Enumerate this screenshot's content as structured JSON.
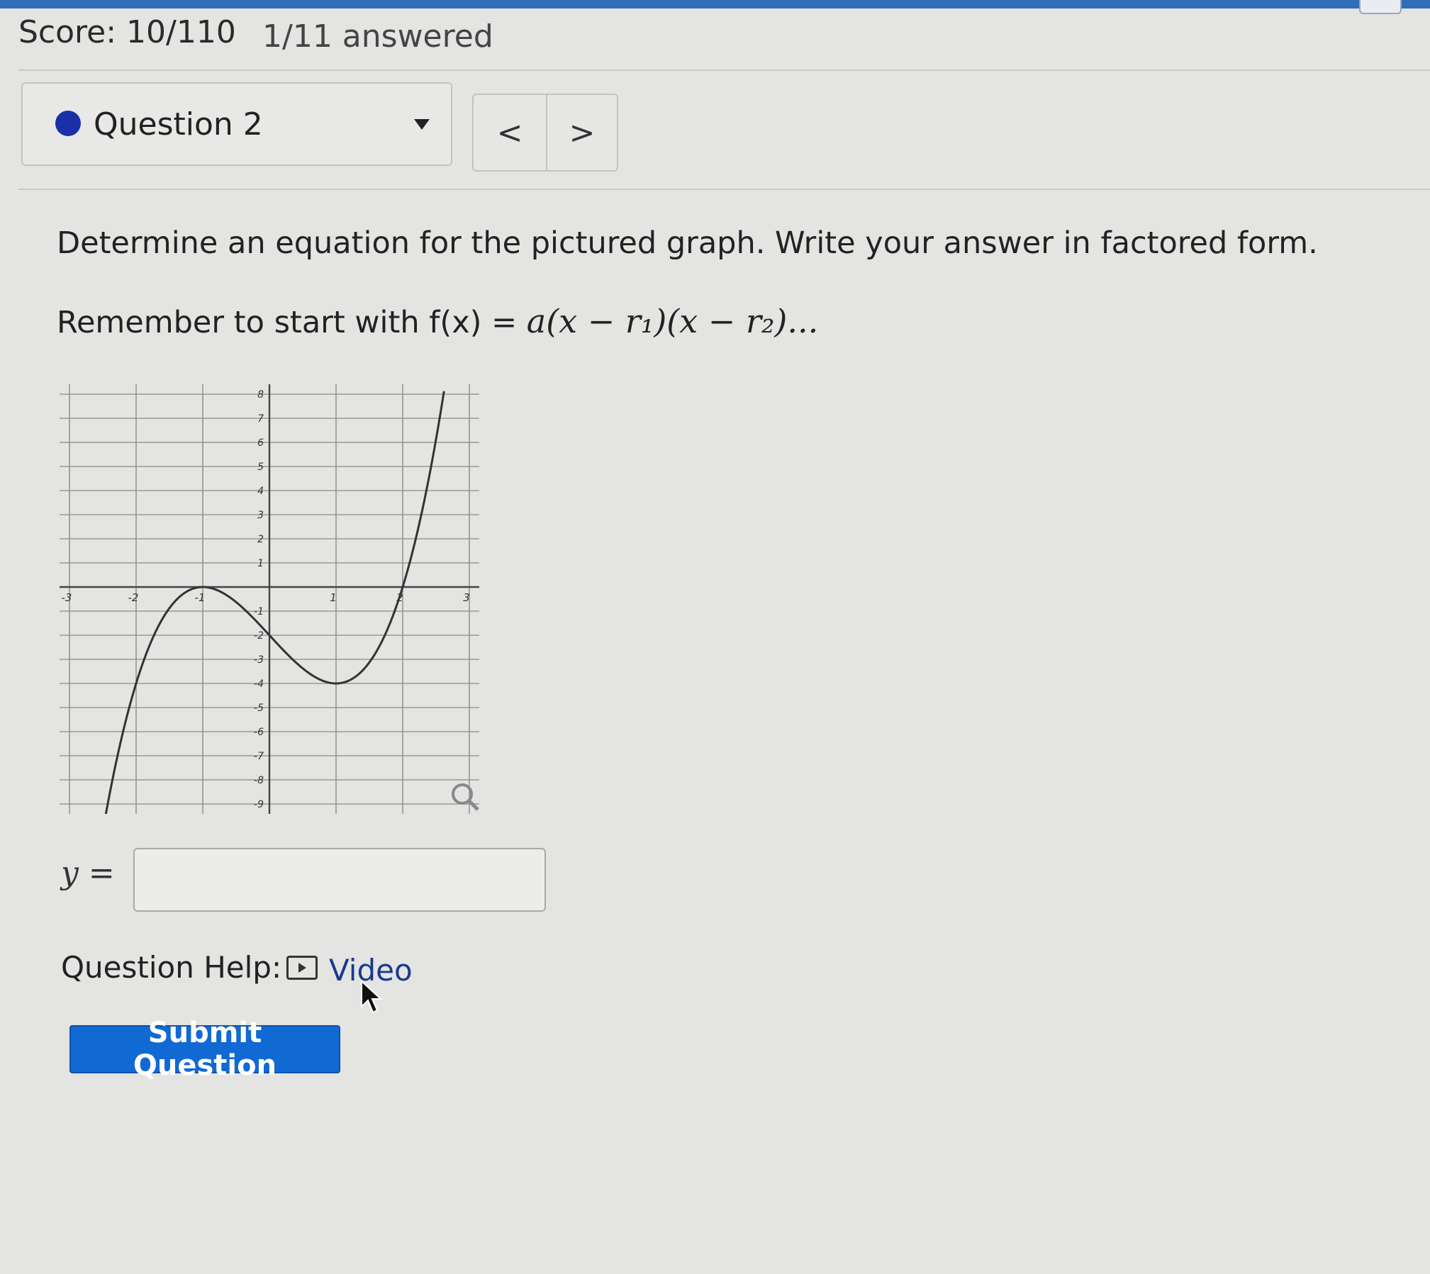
{
  "header": {
    "score": "Score: 10/110",
    "answered": "1/11 answered"
  },
  "question_nav": {
    "current_label": "Question 2",
    "prev_symbol": "<",
    "next_symbol": ">"
  },
  "question": {
    "prompt": "Determine an equation for the pictured graph. Write your answer in factored form.",
    "reminder_prefix": "Remember to start with f(x) = ",
    "reminder_math": "a(x − r₁)(x − r₂)..."
  },
  "graph": {
    "x_ticks": [
      "-3",
      "-2",
      "-1",
      "1",
      "2",
      "3"
    ],
    "y_ticks": [
      "8",
      "7",
      "6",
      "5",
      "4",
      "3",
      "2",
      "1",
      "-1",
      "-2",
      "-3",
      "-4",
      "-5",
      "-6",
      "-7",
      "-8",
      "-9"
    ]
  },
  "answer": {
    "label": "y =",
    "value": ""
  },
  "help": {
    "label": "Question Help:",
    "video_label": "Video"
  },
  "submit_label": "Submit Question",
  "colors": {
    "accent_blue": "#1169d3",
    "question_dot": "#1a2fa8",
    "link": "#1a3a8f"
  }
}
